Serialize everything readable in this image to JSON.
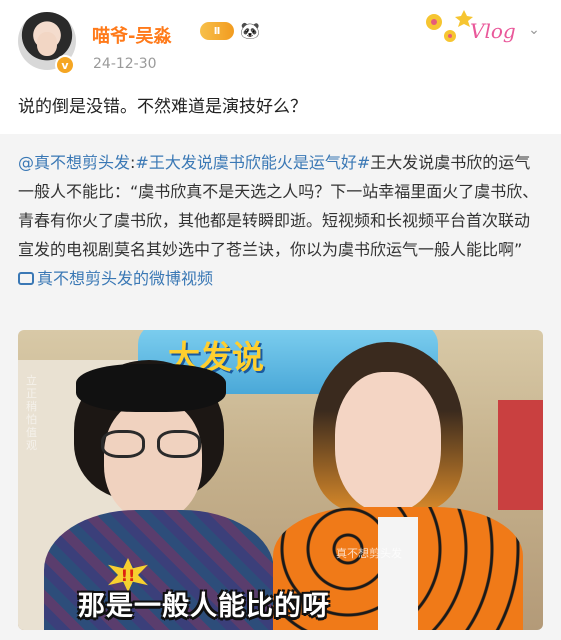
{
  "user": {
    "name": "喵爷-吴淼",
    "rank_badge": "Ⅱ",
    "verified_badge": "v",
    "timestamp": "24-12-30",
    "sticker_text": "Vlog"
  },
  "post": {
    "text": "说的倒是没错。不然难道是演技好么？"
  },
  "repost": {
    "mention": "@真不想剪头发",
    "separator": ":",
    "hashtag1": "#王大发说虞书欣能火是运气好#",
    "body": "王大发说虞书欣的运气一般人不能比：“虞书欣真不是天选之人吗？下一站幸福里面火了虞书欣、青春有你火了虞书欣，其他都是转瞬即逝。短视频和长视频平台首次联动宣发的电视剧莫名其妙选中了苍兰诀，你以为虞书欣运气一般人能比啊”",
    "video_link": "真不想剪头发的微博视频"
  },
  "video": {
    "sign_text": "大发说",
    "caption": "那是一般人能比的呀",
    "burst_text": "!!",
    "watermark_left": "立正稍怕值观",
    "watermark_right": "真不想剪头发"
  },
  "colors": {
    "username": "#ff7a1a",
    "link": "#3a78b5",
    "repost_bg": "#f4f4f4",
    "timestamp": "#9a9a9a"
  },
  "icons": {
    "dropdown": "chevron-down-icon",
    "panda": "panda-icon",
    "video_link": "video-link-icon"
  }
}
